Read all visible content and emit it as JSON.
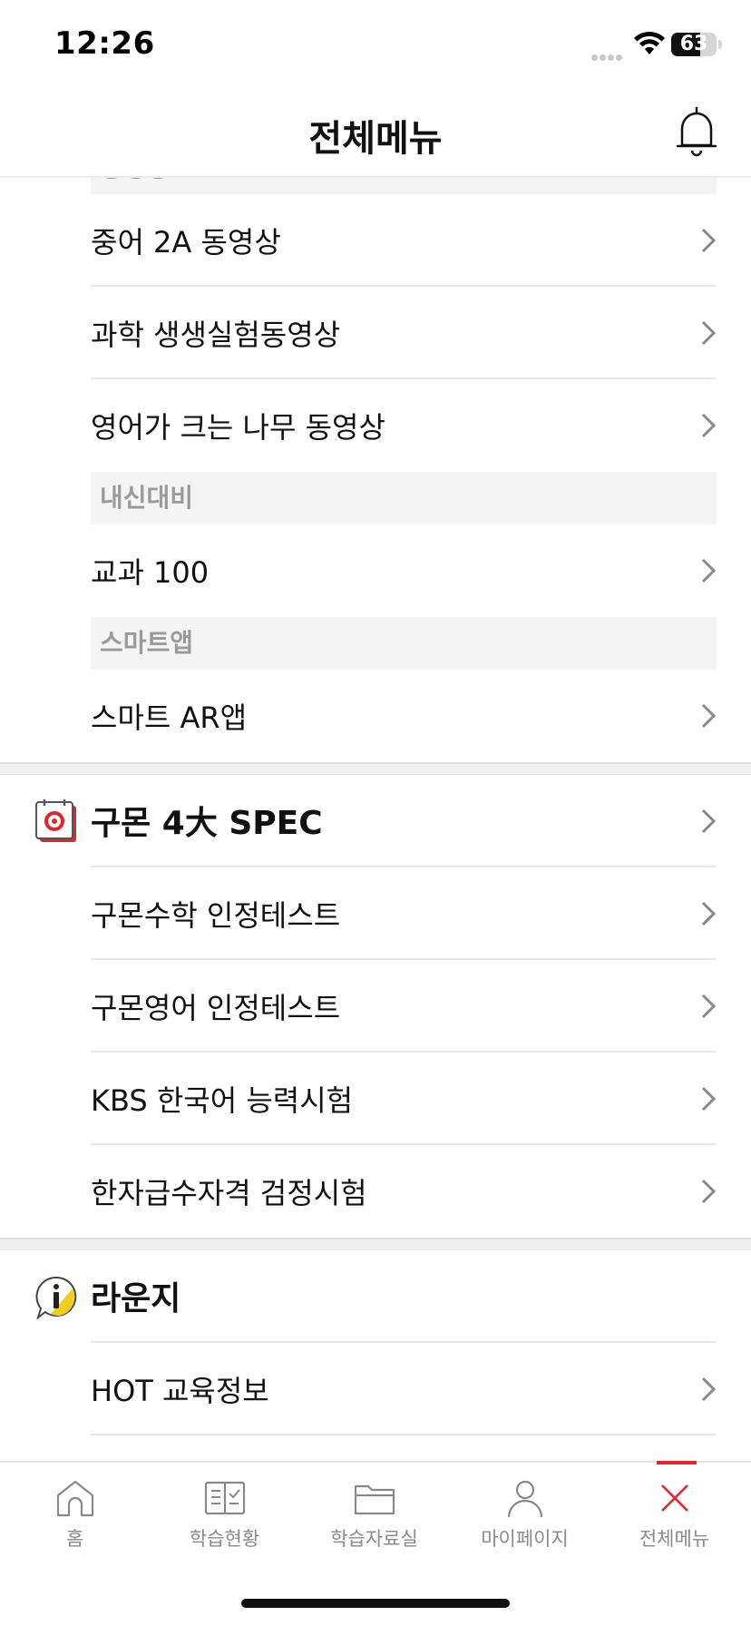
{
  "status_bar": {
    "time": "12:26",
    "battery": "63",
    "battery_level_percent": 63
  },
  "header": {
    "title": "전체메뉴",
    "bell_icon": "bell-icon"
  },
  "partial_subheader": "동영상",
  "video_items": [
    "중어 2A 동영상",
    "과학 생생실험동영상",
    "영어가 크는 나무 동영상"
  ],
  "naesin": {
    "subheader": "내신대비",
    "items": [
      "교과 100"
    ]
  },
  "smartapp": {
    "subheader": "스마트앱",
    "items": [
      "스마트 AR앱"
    ]
  },
  "spec": {
    "title": "구몬 4大 SPEC",
    "icon": "calendar-target-icon",
    "items": [
      "구몬수학 인정테스트",
      "구몬영어 인정테스트",
      "KBS 한국어 능력시험",
      "한자급수자격 검정시험"
    ]
  },
  "lounge": {
    "title": "라운지",
    "icon": "info-speech-bubble-icon",
    "items": [
      "HOT 교육정보"
    ]
  },
  "tabbar": {
    "tabs": [
      {
        "label": "홈",
        "icon": "home-icon"
      },
      {
        "label": "학습현황",
        "icon": "book-check-icon"
      },
      {
        "label": "학습자료실",
        "icon": "folder-icon"
      },
      {
        "label": "마이페이지",
        "icon": "person-icon"
      },
      {
        "label": "전체메뉴",
        "icon": "close-icon"
      }
    ],
    "active_index": 4
  },
  "colors": {
    "accent": "#e0262b",
    "subheader_bg": "#f4f4f4",
    "subheader_text": "#9a9a9a"
  }
}
